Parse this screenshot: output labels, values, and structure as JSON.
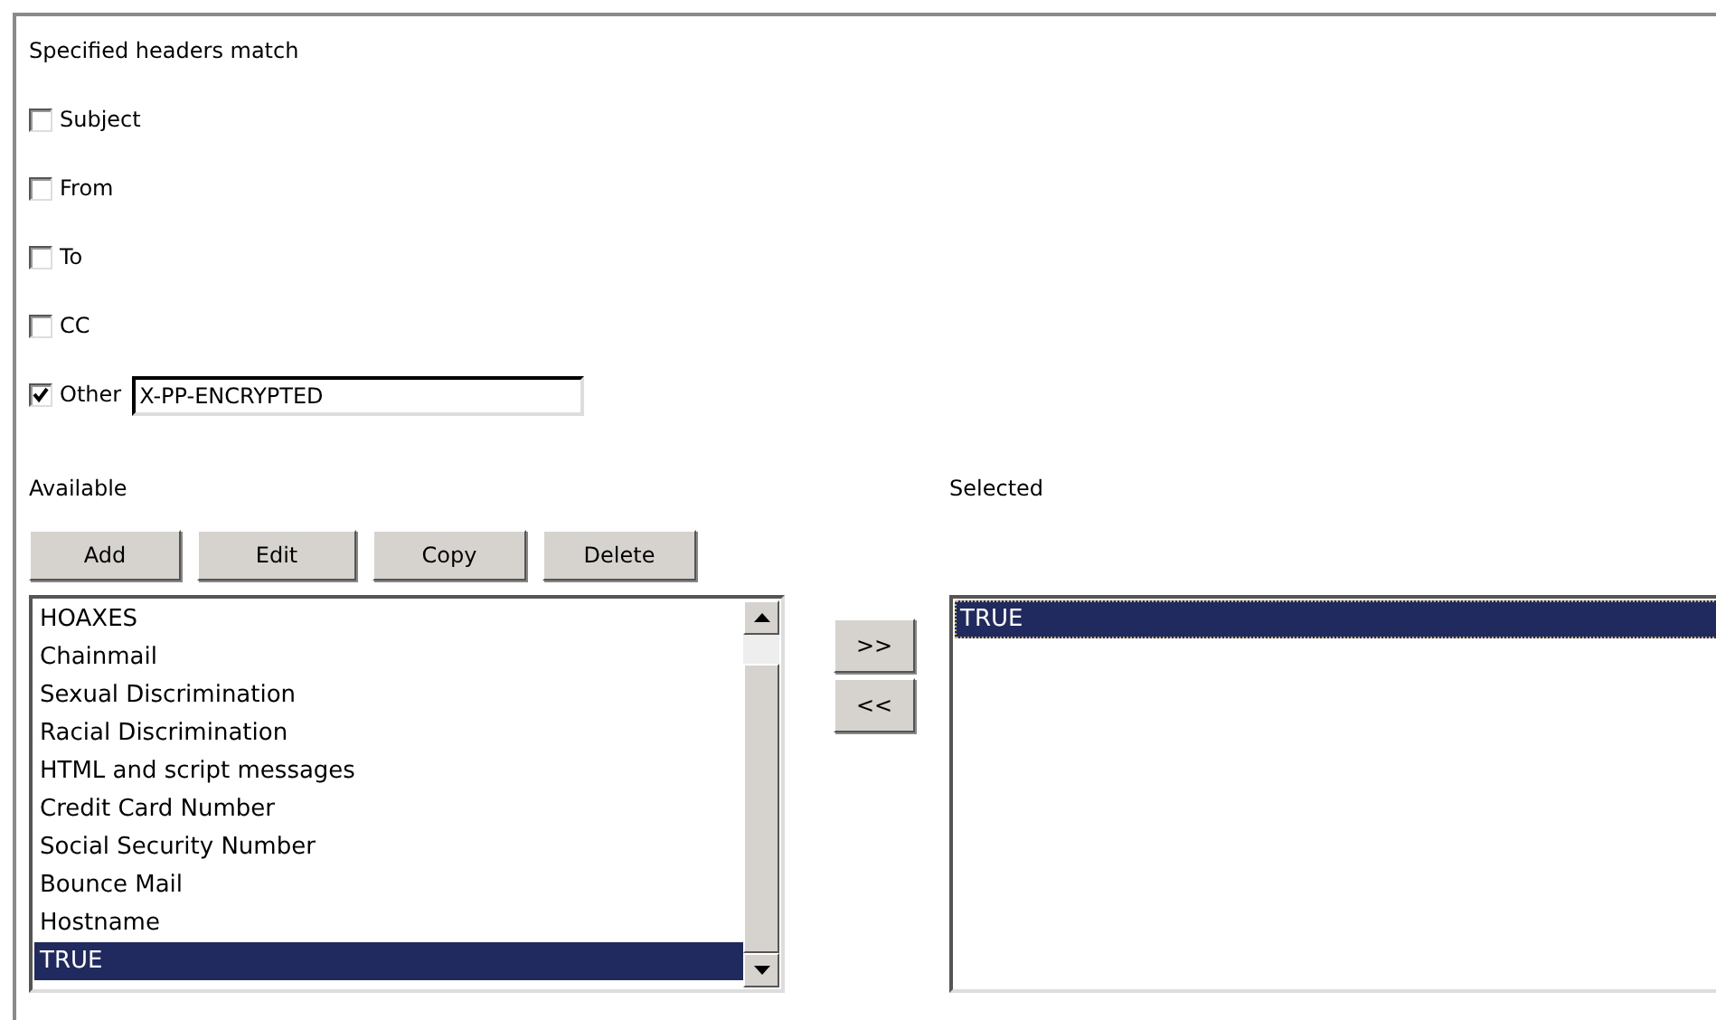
{
  "heading": "Specified headers match",
  "headers": [
    {
      "label": "Subject",
      "checked": false
    },
    {
      "label": "From",
      "checked": false
    },
    {
      "label": "To",
      "checked": false
    },
    {
      "label": "CC",
      "checked": false
    },
    {
      "label": "Other",
      "checked": true,
      "value": "X-PP-ENCRYPTED"
    }
  ],
  "available": {
    "label": "Available",
    "buttons": [
      "Add",
      "Edit",
      "Copy",
      "Delete"
    ],
    "items": [
      {
        "text": "HOAXES",
        "selected": false
      },
      {
        "text": "Chainmail",
        "selected": false
      },
      {
        "text": "Sexual Discrimination",
        "selected": false
      },
      {
        "text": "Racial Discrimination",
        "selected": false
      },
      {
        "text": "HTML and script messages",
        "selected": false
      },
      {
        "text": "Credit Card Number",
        "selected": false
      },
      {
        "text": "Social Security Number",
        "selected": false
      },
      {
        "text": "Bounce Mail",
        "selected": false
      },
      {
        "text": "Hostname",
        "selected": false
      },
      {
        "text": "TRUE",
        "selected": true
      }
    ]
  },
  "move_buttons": [
    ">>",
    "<<"
  ],
  "selected": {
    "label": "Selected",
    "items": [
      {
        "text": "TRUE",
        "selected": true
      }
    ]
  }
}
